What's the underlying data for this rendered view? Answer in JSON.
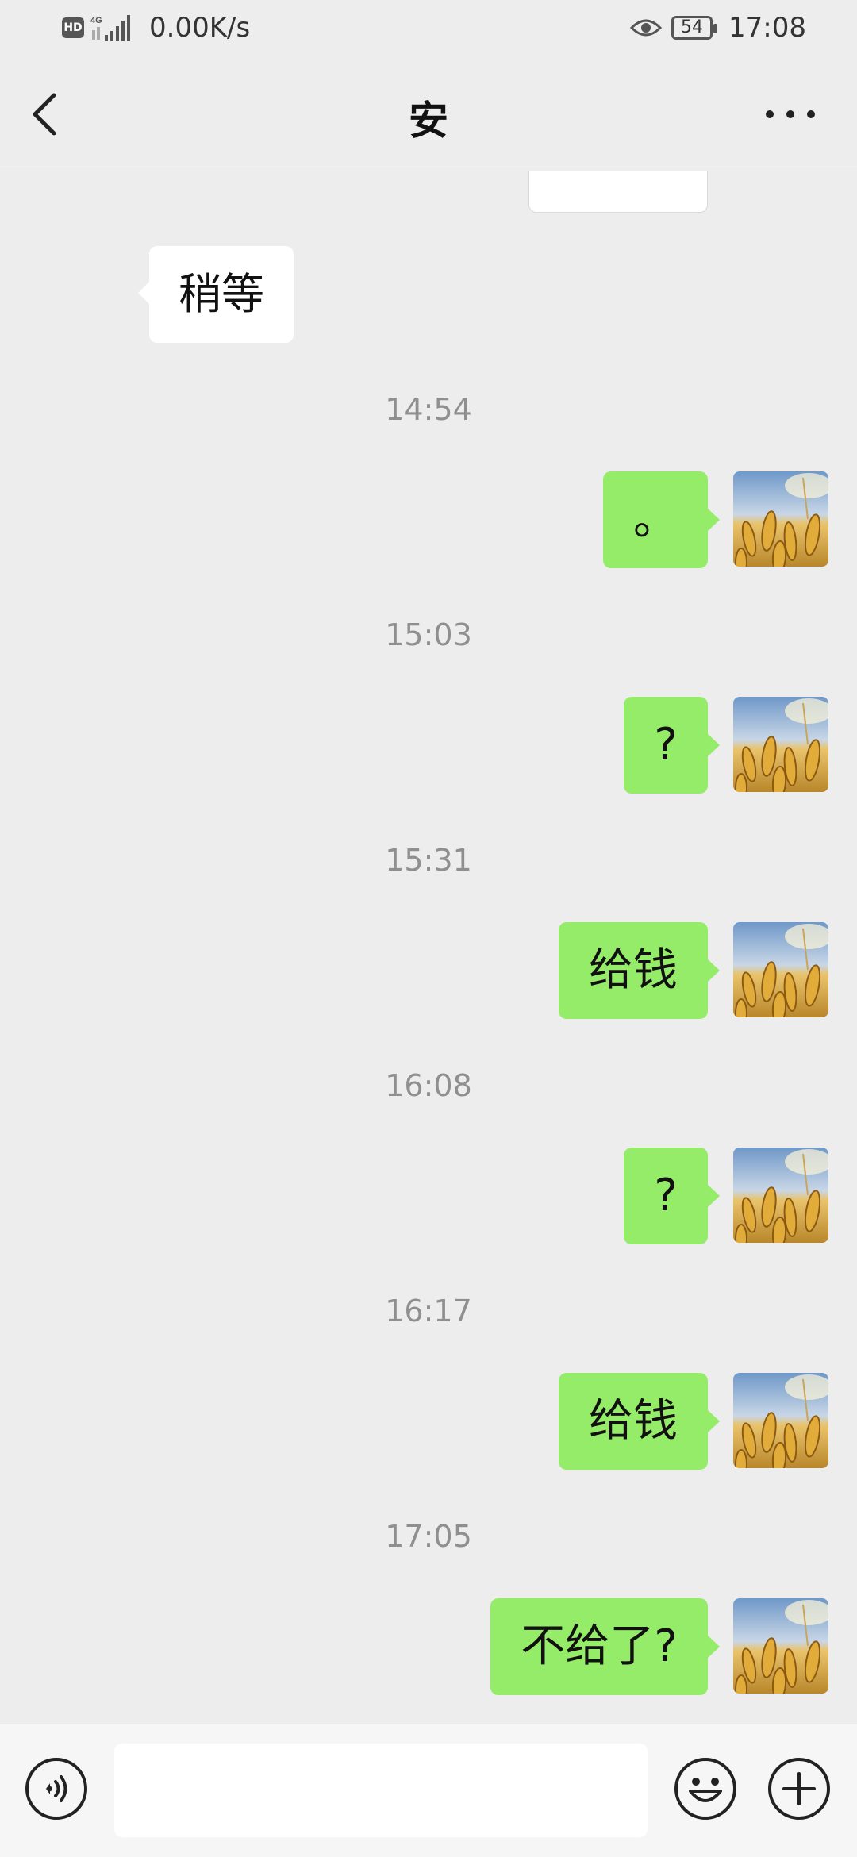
{
  "status_bar": {
    "hd_badge": "HD",
    "network_type": "4G",
    "net_speed": "0.00K/s",
    "battery_level": "54",
    "time": "17:08"
  },
  "header": {
    "title": "安",
    "back_icon": "chevron-left-icon",
    "more_icon": "more-dots-icon"
  },
  "messages": {
    "received": [
      {
        "text": "稍等"
      }
    ],
    "sent": [
      {
        "timestamp": "14:54",
        "text": "。"
      },
      {
        "timestamp": "15:03",
        "text": "?"
      },
      {
        "timestamp": "15:31",
        "text": "给钱"
      },
      {
        "timestamp": "16:08",
        "text": "?"
      },
      {
        "timestamp": "16:17",
        "text": "给钱"
      },
      {
        "timestamp": "17:05",
        "text": "不给了?"
      }
    ]
  },
  "input_bar": {
    "voice_icon": "voice-icon",
    "text_value": "",
    "emoji_icon": "emoji-icon",
    "plus_icon": "plus-icon"
  },
  "colors": {
    "background": "#ededed",
    "sent_bubble": "#95ec69",
    "received_bubble": "#ffffff",
    "timestamp": "#8f8f8f"
  }
}
